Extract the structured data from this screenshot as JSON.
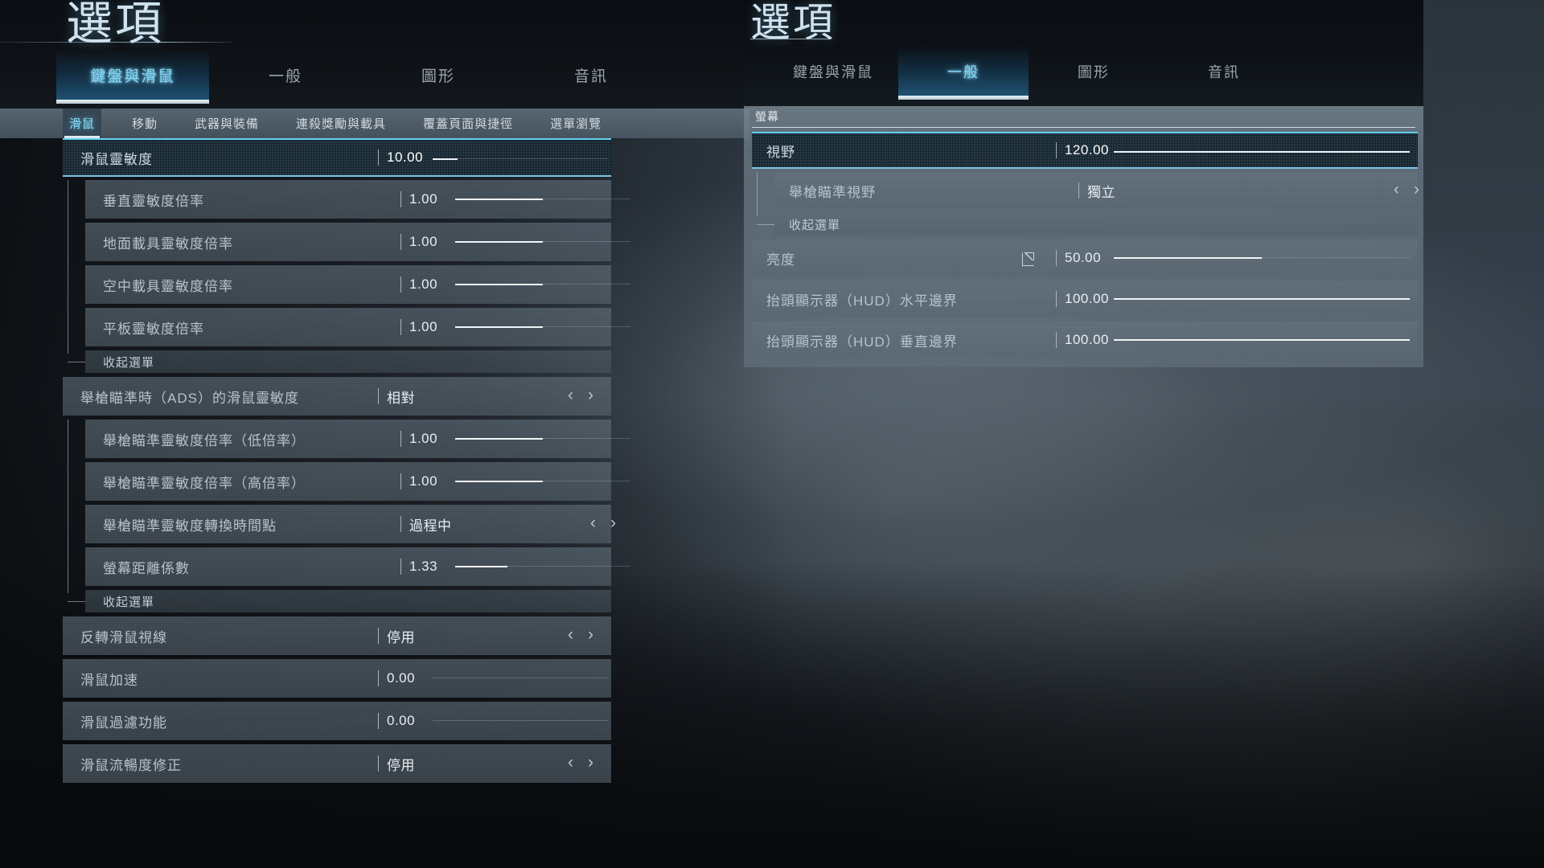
{
  "left_panel": {
    "title": "選項",
    "tabs": [
      {
        "label": "鍵盤與滑鼠",
        "active": true
      },
      {
        "label": "一般",
        "active": false
      },
      {
        "label": "圖形",
        "active": false
      },
      {
        "label": "音訊",
        "active": false
      }
    ],
    "subtabs": [
      {
        "label": "滑鼠",
        "active": true
      },
      {
        "label": "移動",
        "active": false
      },
      {
        "label": "武器與裝備",
        "active": false
      },
      {
        "label": "連殺獎勵與載具",
        "active": false
      },
      {
        "label": "覆蓋頁面與捷徑",
        "active": false
      },
      {
        "label": "選單瀏覽",
        "active": false
      }
    ],
    "rows": [
      {
        "label": "滑鼠靈敏度",
        "value": "10.00",
        "control": "slider",
        "fill_pct": 14,
        "selected": true,
        "indent": 0
      },
      {
        "label": "垂直靈敏度倍率",
        "value": "1.00",
        "control": "slider",
        "fill_pct": 50,
        "selected": false,
        "indent": 1
      },
      {
        "label": "地面載具靈敏度倍率",
        "value": "1.00",
        "control": "slider",
        "fill_pct": 50,
        "selected": false,
        "indent": 1
      },
      {
        "label": "空中載具靈敏度倍率",
        "value": "1.00",
        "control": "slider",
        "fill_pct": 50,
        "selected": false,
        "indent": 1
      },
      {
        "label": "平板靈敏度倍率",
        "value": "1.00",
        "control": "slider",
        "fill_pct": 50,
        "selected": false,
        "indent": 1
      },
      {
        "label": "收起選單",
        "control": "collapse",
        "indent": 1
      },
      {
        "label": "舉槍瞄準時（ADS）的滑鼠靈敏度",
        "value": "相對",
        "control": "stepper",
        "selected": false,
        "indent": 0
      },
      {
        "label": "舉槍瞄準靈敏度倍率（低倍率）",
        "value": "1.00",
        "control": "slider",
        "fill_pct": 50,
        "selected": false,
        "indent": 1
      },
      {
        "label": "舉槍瞄準靈敏度倍率（高倍率）",
        "value": "1.00",
        "control": "slider",
        "fill_pct": 50,
        "selected": false,
        "indent": 1
      },
      {
        "label": "舉槍瞄準靈敏度轉換時間點",
        "value": "過程中",
        "control": "stepper",
        "selected": false,
        "indent": 1
      },
      {
        "label": "螢幕距離係數",
        "value": "1.33",
        "control": "slider",
        "fill_pct": 30,
        "selected": false,
        "indent": 1
      },
      {
        "label": "收起選單",
        "control": "collapse",
        "indent": 1
      },
      {
        "label": "反轉滑鼠視線",
        "value": "停用",
        "control": "stepper",
        "selected": false,
        "indent": 0
      },
      {
        "label": "滑鼠加速",
        "value": "0.00",
        "control": "slider",
        "fill_pct": 0,
        "selected": false,
        "indent": 0
      },
      {
        "label": "滑鼠過濾功能",
        "value": "0.00",
        "control": "slider",
        "fill_pct": 0,
        "selected": false,
        "indent": 0
      },
      {
        "label": "滑鼠流暢度修正",
        "value": "停用",
        "control": "stepper",
        "selected": false,
        "indent": 0
      }
    ]
  },
  "right_panel": {
    "title": "選項",
    "tabs": [
      {
        "label": "鍵盤與滑鼠",
        "active": false
      },
      {
        "label": "一般",
        "active": true
      },
      {
        "label": "圖形",
        "active": false
      },
      {
        "label": "音訊",
        "active": false
      }
    ],
    "section_title": "螢幕",
    "rows": [
      {
        "label": "視野",
        "value": "120.00",
        "control": "slider",
        "fill_pct": 100,
        "selected": true,
        "indent": 0,
        "icon": ""
      },
      {
        "label": "舉槍瞄準視野",
        "value": "獨立",
        "control": "stepper",
        "selected": false,
        "indent": 1,
        "icon": ""
      },
      {
        "label": "收起選單",
        "control": "collapse",
        "indent": 1
      },
      {
        "label": "亮度",
        "value": "50.00",
        "control": "slider",
        "fill_pct": 50,
        "selected": false,
        "indent": 0,
        "icon": "external-link-icon"
      },
      {
        "label": "抬頭顯示器（HUD）水平邊界",
        "value": "100.00",
        "control": "slider",
        "fill_pct": 100,
        "selected": false,
        "indent": 0,
        "icon": ""
      },
      {
        "label": "抬頭顯示器（HUD）垂直邊界",
        "value": "100.00",
        "control": "slider",
        "fill_pct": 100,
        "selected": false,
        "indent": 0,
        "icon": ""
      }
    ]
  },
  "icons": {
    "chevron_left": "‹",
    "chevron_right": "›"
  },
  "colors": {
    "accent_cyan": "#7fd8f7",
    "selected_border": "#63d2f2",
    "panel_bg": "#64737f",
    "text_primary": "#e7eef3",
    "text_secondary": "#b6c3cc"
  }
}
